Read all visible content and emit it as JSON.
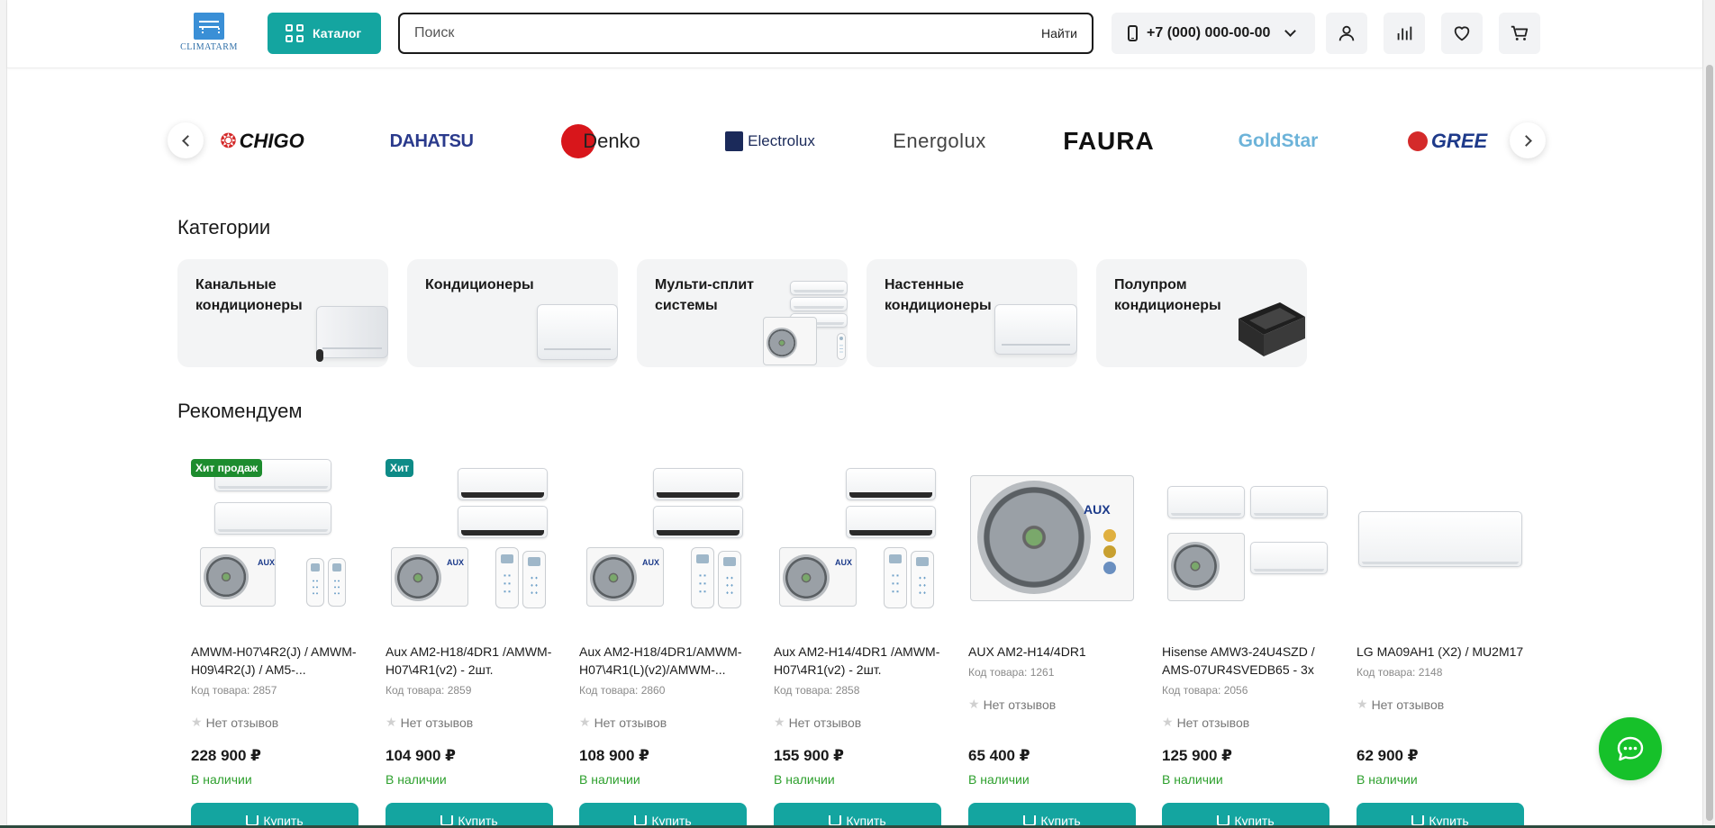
{
  "header": {
    "logo_text": "CLIMATARM",
    "catalog_label": "Каталог",
    "search": {
      "placeholder": "Поиск",
      "value": "",
      "button_label": "Найти"
    },
    "phone": "+7 (000) 000-00-00",
    "icons": [
      "user-icon",
      "compare-icon",
      "heart-icon",
      "cart-icon"
    ]
  },
  "brands": {
    "items": [
      {
        "name": "CHIGO"
      },
      {
        "name": "DAHATSU"
      },
      {
        "name": "Denko"
      },
      {
        "name": "Electrolux"
      },
      {
        "name": "Energolux"
      },
      {
        "name": "FAURA"
      },
      {
        "name": "GoldStar"
      },
      {
        "name": "GREE"
      }
    ]
  },
  "categories": {
    "title": "Категории",
    "items": [
      {
        "label": "Канальные\nкондиционеры"
      },
      {
        "label": "Кондиционеры"
      },
      {
        "label": "Мульти-сплит\nсистемы"
      },
      {
        "label": "Настенные\nкондиционеры"
      },
      {
        "label": "Полупром\nкондиционеры"
      }
    ]
  },
  "recommend": {
    "title": "Рекомендуем",
    "products": [
      {
        "badge": "Хит продаж",
        "name": "AMWM-H07\\4R2(J) / AMWM-H09\\4R2(J) / AM5-...",
        "code": "Код товара: 2857",
        "reviews": "Нет отзывов",
        "price": "228 900 ₽",
        "stock": "В наличии",
        "buy": "Купить"
      },
      {
        "badge": "Хит",
        "name": "Aux AM2-H18/4DR1 /AMWM-H07\\4R1(v2) - 2шт.",
        "code": "Код товара: 2859",
        "reviews": "Нет отзывов",
        "price": "104 900 ₽",
        "stock": "В наличии",
        "buy": "Купить"
      },
      {
        "badge": "",
        "name": "Aux AM2-H18/4DR1/AMWM-H07\\4R1(L)(v2)/AMWM-...",
        "code": "Код товара: 2860",
        "reviews": "Нет отзывов",
        "price": "108 900 ₽",
        "stock": "В наличии",
        "buy": "Купить"
      },
      {
        "badge": "",
        "name": "Aux AM2-H14/4DR1 /AMWM-H07\\4R1(v2) - 2шт.",
        "code": "Код товара: 2858",
        "reviews": "Нет отзывов",
        "price": "155 900 ₽",
        "stock": "В наличии",
        "buy": "Купить"
      },
      {
        "badge": "",
        "name": "AUX AM2-H14/4DR1",
        "code": "Код товара: 1261",
        "reviews": "Нет отзывов",
        "price": "65 400 ₽",
        "stock": "В наличии",
        "buy": "Купить"
      },
      {
        "badge": "",
        "name": "Hisense AMW3-24U4SZD / AMS-07UR4SVEDB65 - 3x",
        "code": "Код товара: 2056",
        "reviews": "Нет отзывов",
        "price": "125 900 ₽",
        "stock": "В наличии",
        "buy": "Купить"
      },
      {
        "badge": "",
        "name": "LG MA09AH1 (X2) / MU2M17",
        "code": "Код товара: 2148",
        "reviews": "Нет отзывов",
        "price": "62 900 ₽",
        "stock": "В наличии",
        "buy": "Купить"
      }
    ]
  },
  "colors": {
    "accent": "#14a5a0",
    "stock_green": "#2ea02e",
    "chat_green": "#16c12a",
    "badge_hit_sale": "#1d8c2e",
    "badge_hit": "#0e8b87"
  }
}
